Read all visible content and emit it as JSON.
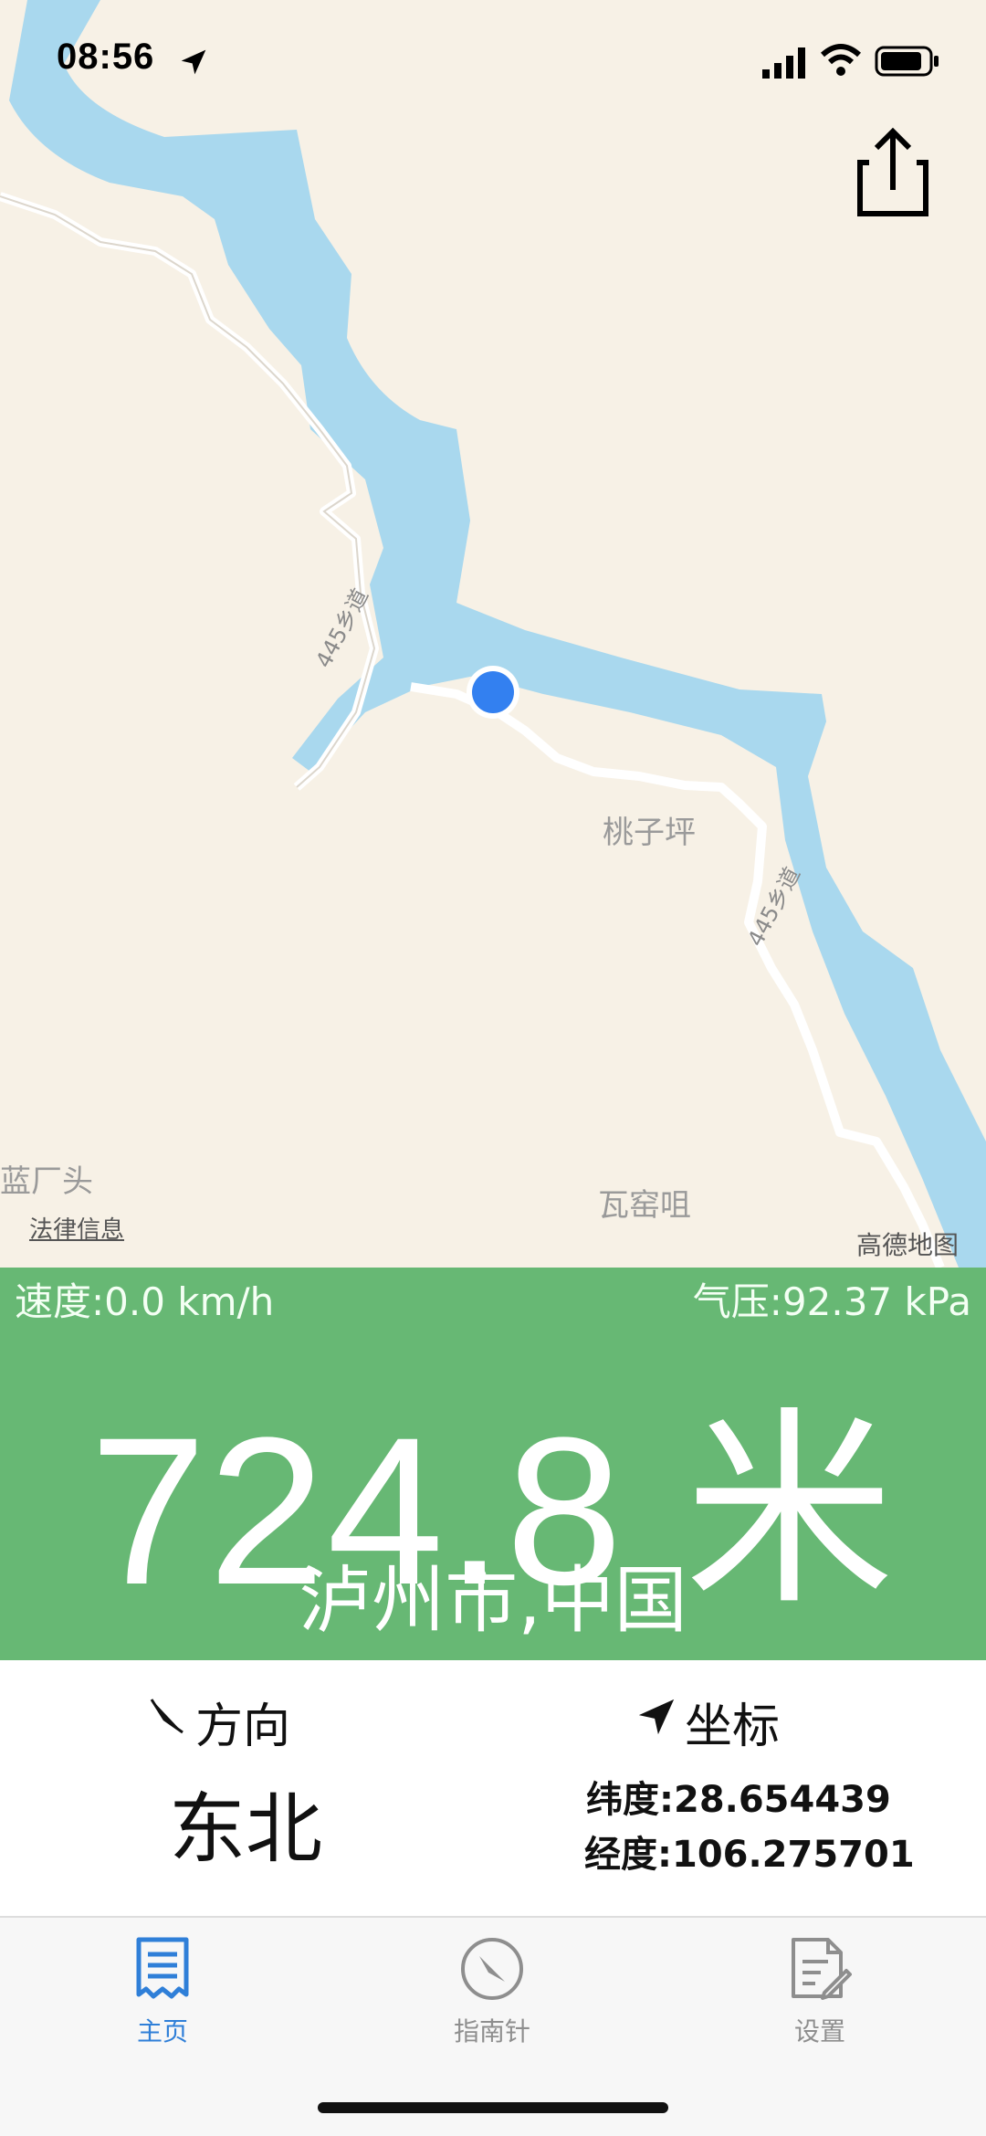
{
  "status_bar": {
    "time": "08:56"
  },
  "map": {
    "places": [
      "桃子坪",
      "蓝厂头",
      "瓦窑咀"
    ],
    "road_labels": [
      "445乡道",
      "445乡道"
    ],
    "legal_link": "法律信息",
    "provider": "高德地图"
  },
  "panel": {
    "speed": "速度:0.0 km/h",
    "pressure": "气压:92.37 kPa",
    "altitude": "724.8 米",
    "city": "泸州市,中国",
    "background_color": "#67b874"
  },
  "info": {
    "direction_label": "方向",
    "direction_value": "东北",
    "coord_label": "坐标",
    "latitude": "纬度:28.654439",
    "longitude": "经度:106.275701"
  },
  "tabs": [
    {
      "label": "主页",
      "icon": "document-icon",
      "active": true
    },
    {
      "label": "指南针",
      "icon": "compass-icon",
      "active": false
    },
    {
      "label": "设置",
      "icon": "settings-doc-icon",
      "active": false
    }
  ],
  "colors": {
    "accent": "#2f7fd8",
    "water": "#a9d8ee",
    "land": "#f7f1e6"
  }
}
